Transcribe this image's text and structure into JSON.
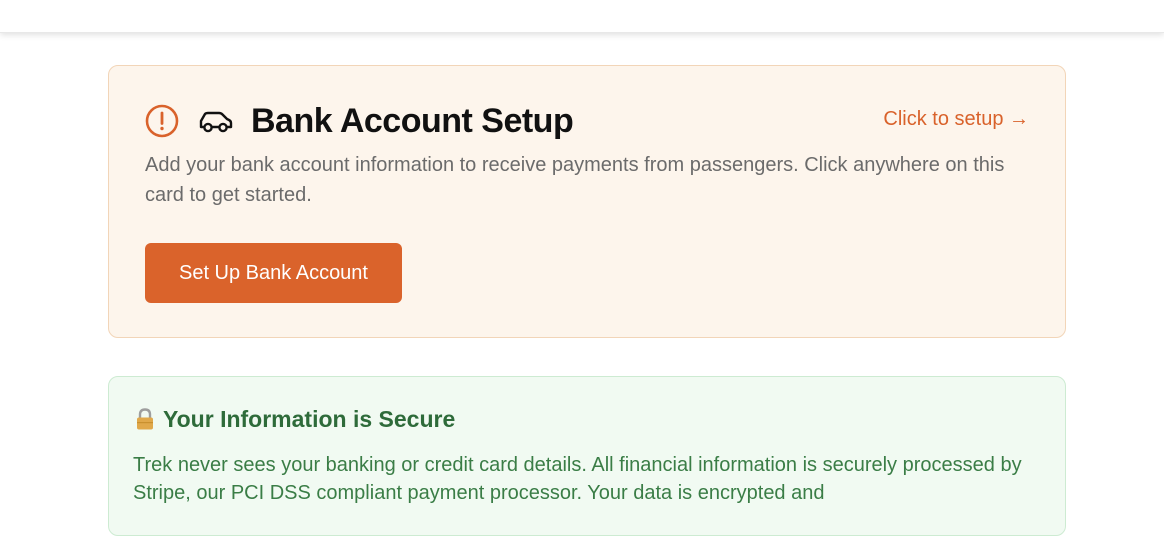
{
  "setup_card": {
    "title": "Bank Account Setup",
    "link_label": "Click to setup →",
    "description": "Add your bank account information to receive payments from passengers. Click anywhere on this card to get started.",
    "button_label": "Set Up Bank Account",
    "icons": [
      "alert-circle-icon",
      "car-icon"
    ]
  },
  "secure_card": {
    "title": "Your Information is Secure",
    "description": "Trek never sees your banking or credit card details. All financial information is securely processed by Stripe, our PCI DSS compliant payment processor. Your data is encrypted and",
    "icons": [
      "lock-icon"
    ]
  },
  "colors": {
    "accent": "#da632b",
    "setup_background": "#fdf5ec",
    "secure_background": "#f1faf2",
    "secure_text": "#2e6b3a"
  }
}
